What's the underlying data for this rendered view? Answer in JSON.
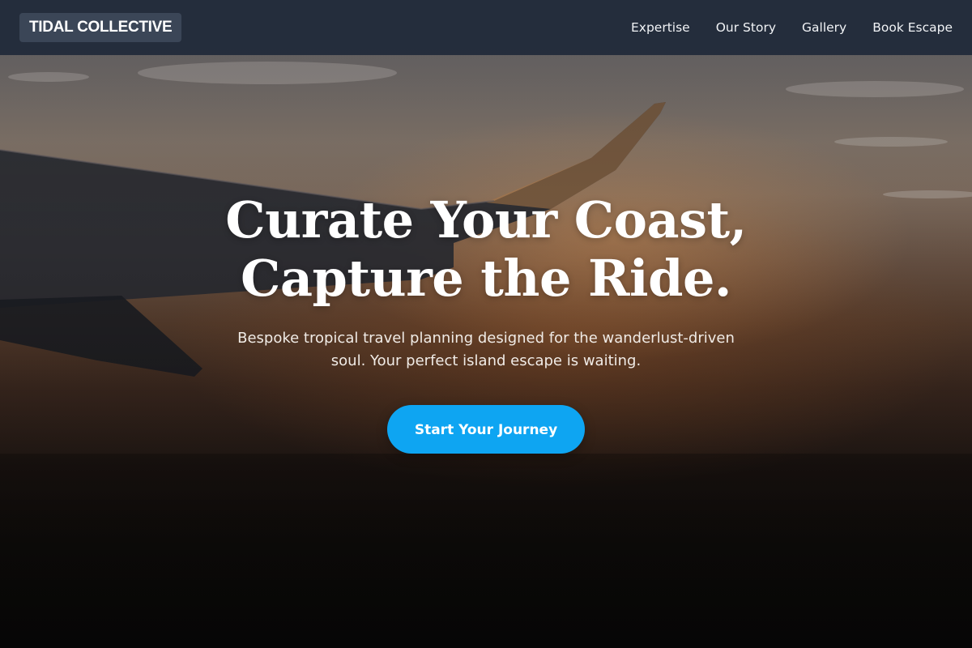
{
  "brand": {
    "name": "TIDAL COLLECTIVE"
  },
  "nav": {
    "links": [
      {
        "label": "Expertise"
      },
      {
        "label": "Our Story"
      },
      {
        "label": "Gallery"
      },
      {
        "label": "Book Escape"
      }
    ]
  },
  "hero": {
    "title_line1": "Curate Your Coast,",
    "title_line2": "Capture the Ride.",
    "subtitle": "Bespoke tropical travel planning designed for the wanderlust-driven soul. Your perfect island escape is waiting.",
    "cta_label": "Start Your Journey",
    "background_scene": "airplane-wing-sunset-photo"
  },
  "colors": {
    "navbar_bg": "#1f293a",
    "cta_bg": "#0ea5f2",
    "text": "#ffffff"
  }
}
